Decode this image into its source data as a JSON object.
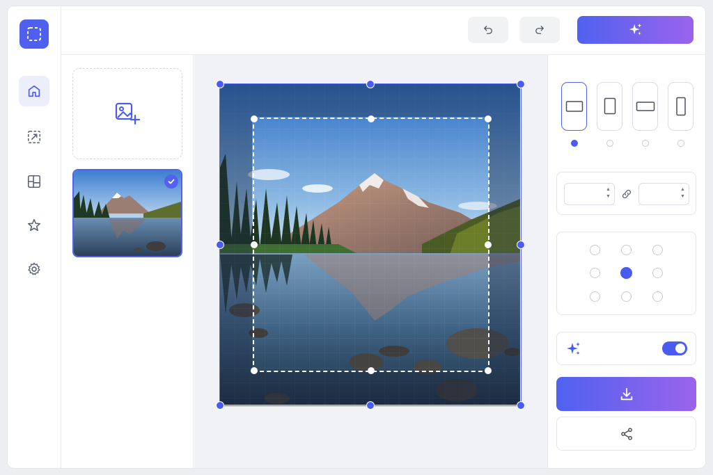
{
  "icons": {
    "logo": "crop-select-icon",
    "rail": [
      "home-icon",
      "resize-icon",
      "layout-icon",
      "star-icon",
      "gear-icon"
    ],
    "undo": "undo-icon",
    "redo": "redo-icon",
    "magic": "sparkles-icon",
    "upload": "image-add-icon",
    "link": "link-icon",
    "auto": "sparkles-icon",
    "download": "download-icon",
    "share": "share-icon"
  },
  "colors": {
    "accent": "#4a5bf0",
    "gradient_start": "#4f62f0",
    "gradient_end": "#9b63ec"
  },
  "aspect_ratios": {
    "shapes": [
      "landscape",
      "portrait",
      "wide",
      "tall"
    ],
    "selected_index": 0
  },
  "size": {
    "width_value": "",
    "height_value": "",
    "aspect_locked": true
  },
  "anchor_grid": {
    "selected_row": 1,
    "selected_col": 1
  },
  "auto_enhance": {
    "enabled": true
  },
  "thumbnail": {
    "selected": true
  }
}
